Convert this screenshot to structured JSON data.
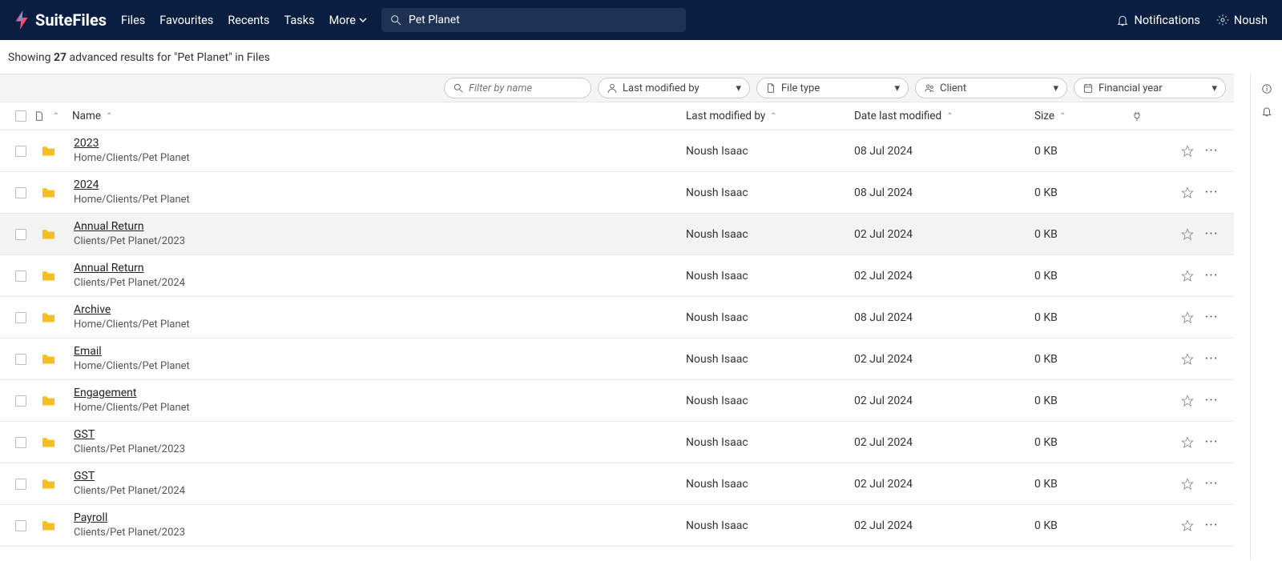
{
  "header": {
    "brand": "SuiteFiles",
    "nav": {
      "files": "Files",
      "favourites": "Favourites",
      "recents": "Recents",
      "tasks": "Tasks",
      "more": "More"
    },
    "search": {
      "value": "Pet Planet"
    },
    "notifications": "Notifications",
    "user": "Noush"
  },
  "results_bar": {
    "prefix": "Showing ",
    "count": "27",
    "mid": " advanced results for  \"",
    "term": "Pet Planet",
    "suffix": "\"  in Files"
  },
  "filters": {
    "name_placeholder": "Filter by name",
    "modified_by": "Last modified by",
    "file_type": "File type",
    "client": "Client",
    "financial_year": "Financial year"
  },
  "columns": {
    "name": "Name",
    "modified_by": "Last modified by",
    "date": "Date last modified",
    "size": "Size"
  },
  "rows": [
    {
      "name": "2023",
      "path": "Home/Clients/Pet Planet",
      "user": "Noush Isaac",
      "date": "08 Jul 2024",
      "size": "0 KB"
    },
    {
      "name": "2024",
      "path": "Home/Clients/Pet Planet",
      "user": "Noush Isaac",
      "date": "08 Jul 2024",
      "size": "0 KB"
    },
    {
      "name": "Annual Return",
      "path": "Clients/Pet Planet/2023",
      "user": "Noush Isaac",
      "date": "02 Jul 2024",
      "size": "0 KB",
      "hovered": true
    },
    {
      "name": "Annual Return",
      "path": "Clients/Pet Planet/2024",
      "user": "Noush Isaac",
      "date": "02 Jul 2024",
      "size": "0 KB"
    },
    {
      "name": "Archive",
      "path": "Home/Clients/Pet Planet",
      "user": "Noush Isaac",
      "date": "08 Jul 2024",
      "size": "0 KB"
    },
    {
      "name": "Email",
      "path": "Home/Clients/Pet Planet",
      "user": "Noush Isaac",
      "date": "02 Jul 2024",
      "size": "0 KB"
    },
    {
      "name": "Engagement",
      "path": "Home/Clients/Pet Planet",
      "user": "Noush Isaac",
      "date": "02 Jul 2024",
      "size": "0 KB"
    },
    {
      "name": "GST",
      "path": "Clients/Pet Planet/2023",
      "user": "Noush Isaac",
      "date": "02 Jul 2024",
      "size": "0 KB"
    },
    {
      "name": "GST",
      "path": "Clients/Pet Planet/2024",
      "user": "Noush Isaac",
      "date": "02 Jul 2024",
      "size": "0 KB"
    },
    {
      "name": "Payroll",
      "path": "Clients/Pet Planet/2023",
      "user": "Noush Isaac",
      "date": "02 Jul 2024",
      "size": "0 KB"
    }
  ]
}
